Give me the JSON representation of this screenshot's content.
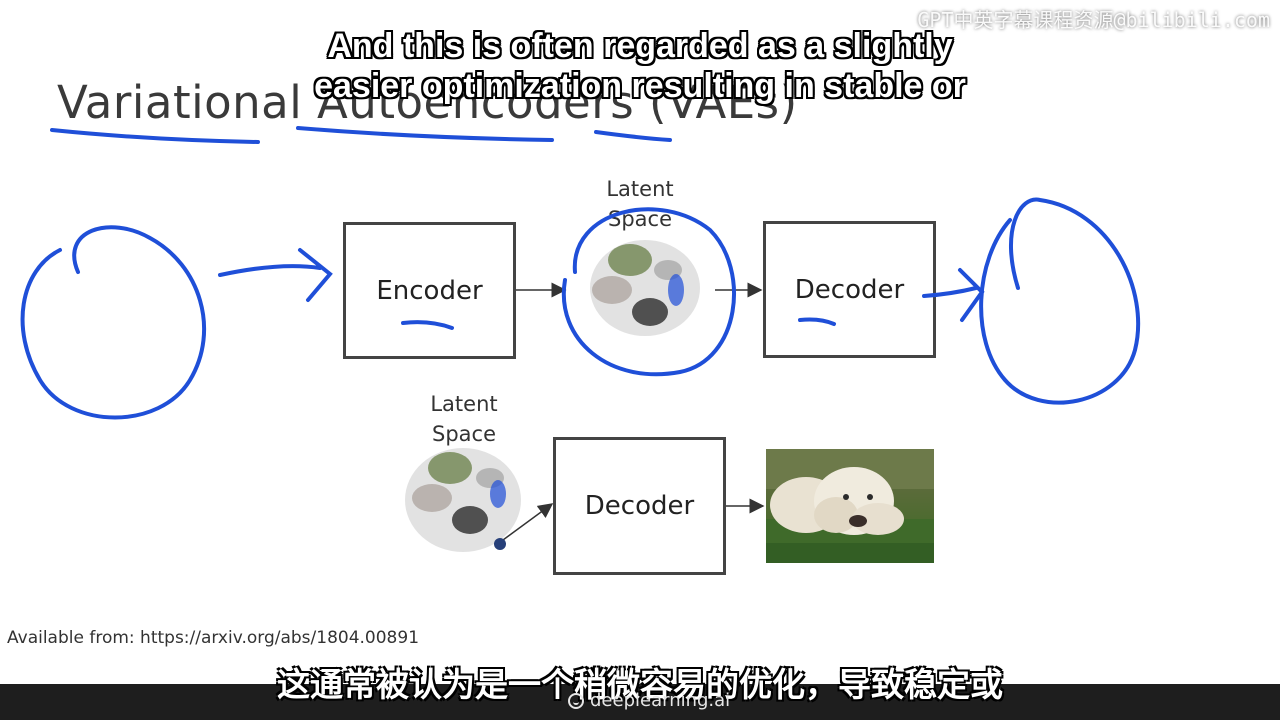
{
  "slide": {
    "title": "Variational Autoencoders (VAEs)",
    "top_diagram": {
      "encoder_label": "Encoder",
      "latent_label_line1": "Latent",
      "latent_label_line2": "Space",
      "decoder_label": "Decoder"
    },
    "bottom_diagram": {
      "latent_label_line1": "Latent",
      "latent_label_line2": "Space",
      "decoder_label": "Decoder",
      "output_image": "dog-photo"
    },
    "source": "Available from: https://arxiv.org/abs/1804.00891"
  },
  "subtitles": {
    "english_line1": "And this is often regarded as a slightly",
    "english_line2": "easier optimization resulting in stable or",
    "chinese": "这通常被认为是一个稍微容易的优化，导致稳定或"
  },
  "watermark": "GPT中英字幕课程资源@bilibili.com",
  "footer": {
    "brand": "deeplearning.ai"
  },
  "colors": {
    "annotation": "#1f4fd8",
    "box_border": "#444444",
    "footer_bg": "#1e1e1e"
  }
}
